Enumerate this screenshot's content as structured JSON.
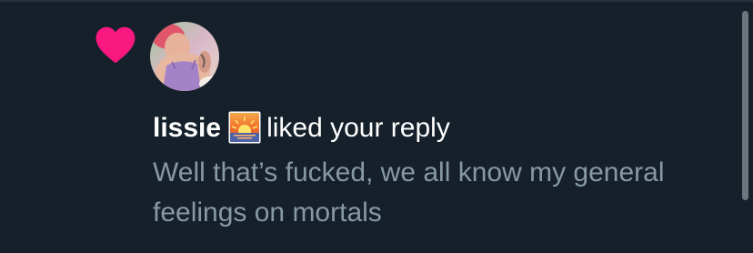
{
  "notification": {
    "type_icon": "heart-icon",
    "user_name": "lissie",
    "name_emoji": "sunrise-icon",
    "action_text": "liked your reply",
    "reply_text": "Well that’s fucked, we all know my general feelings on mortals"
  },
  "colors": {
    "background": "#15202b",
    "heart": "#f91880",
    "primary_text": "#ffffff",
    "secondary_text": "#8899a6"
  }
}
